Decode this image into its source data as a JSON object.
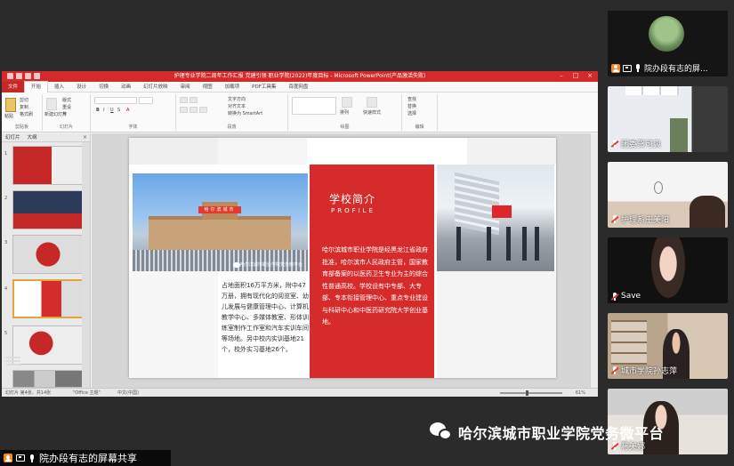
{
  "ppt": {
    "title": "护理专业学院二周年工作汇报 党建引领 职业学院(2022)年度目标 - Microsoft PowerPoint(产品激活失败)",
    "tabs": [
      "文件",
      "开始",
      "插入",
      "设计",
      "切换",
      "动画",
      "幻灯片放映",
      "审阅",
      "视图",
      "加载项",
      "PDF工具集",
      "百度网盘"
    ],
    "active_tab": "开始",
    "ribbon": {
      "paste": "粘贴",
      "cut": "剪切",
      "copy": "复制",
      "format_painter": "格式刷",
      "new_slide": "新建幻灯片",
      "layout": "版式",
      "reset": "重设",
      "section": "节",
      "clipboard_label": "剪贴板",
      "slides_label": "幻灯片",
      "font_label": "字体",
      "paragraph_label": "段落",
      "drawing_label": "绘图",
      "editing_label": "编辑",
      "text_direction": "文字方向",
      "align_text": "对齐文本",
      "convert_smartart": "转换为 SmartArt",
      "arrange": "排列",
      "quick_styles": "快速样式",
      "find": "查找",
      "replace": "替换",
      "select": "选择"
    },
    "panel_tabs": [
      "幻灯片",
      "大纲"
    ],
    "slide_numbers": [
      "1",
      "2",
      "3",
      "4",
      "5"
    ],
    "status": {
      "slide": "幻灯片 第4张，共14张",
      "theme": "\"Office 主题\"",
      "lang": "中文(中国)",
      "zoom": "61%"
    }
  },
  "slide": {
    "heading_cn": "学校简介",
    "heading_en": "PROFILE",
    "photo_sign": "哈尔滨城市",
    "photo_watermark": "哈尔滨城市职业学院党务微平台",
    "left_text": "占地面积16万平方米，附中47万册，拥有现代化的阅览室、幼儿发展与健康管理中心、计算机教学中心、多媒体教室、形体训练室制作工作室和汽车实训车间等场地。另中校内实训基地21个，校外实习基地26个。",
    "body": "哈尔滨城市职业学院是经黑龙江省政府批准，哈尔滨市人民政府主管，国家教育部备案的以医药卫生专业为主的综合性普通高校。学校设有中专部、大专部、专本衔接管理中心、重点专业建设与科研中心和中医药研究院大学创业基地。"
  },
  "participants": [
    {
      "name": "院办段有志的屏...",
      "icons": [
        "user-icon",
        "share-icon",
        "mic-icon"
      ]
    },
    {
      "name": "团委贺可爽",
      "icons": [
        "mic-muted-icon"
      ]
    },
    {
      "name": "护理系王美阳",
      "icons": [
        "mic-muted-icon"
      ]
    },
    {
      "name": "Save",
      "icons": [
        "mic-muted-icon"
      ]
    },
    {
      "name": "城市学院孙志萍",
      "icons": [
        "mic-muted-icon"
      ]
    },
    {
      "name": "蒋美娜",
      "icons": [
        "mic-muted-icon"
      ]
    }
  ],
  "share_bar": {
    "text": "院办段有志的屏幕共享"
  },
  "brand": {
    "text": "哈尔滨城市职业学院党务微平台",
    "icon": "wechat-icon"
  },
  "colors": {
    "accent_red": "#d52b2b",
    "title_red": "#d42a2a",
    "user_orange": "#f08a24"
  }
}
